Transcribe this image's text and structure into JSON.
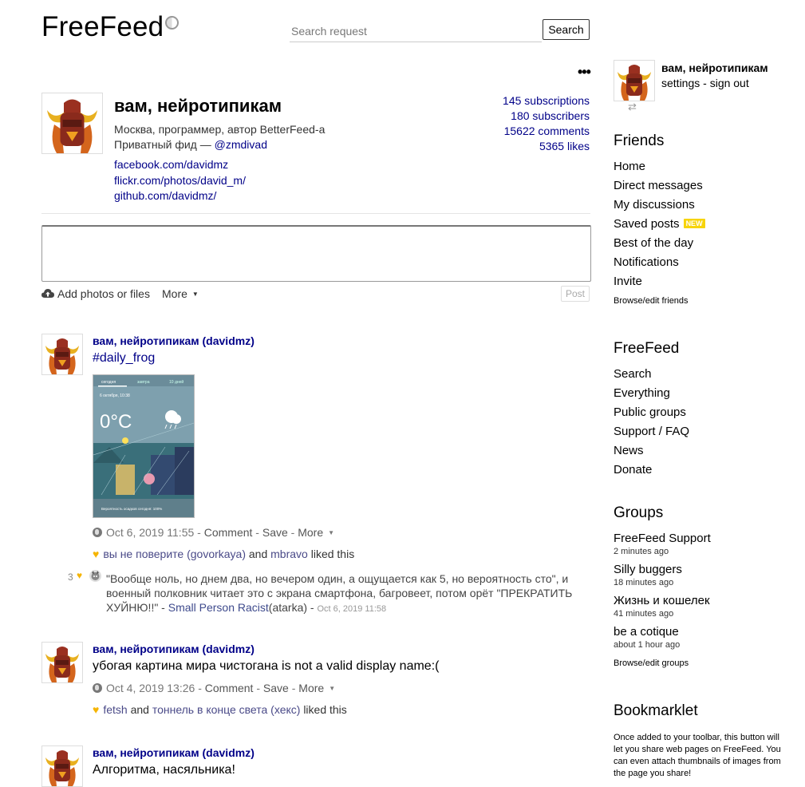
{
  "header": {
    "logo": "FreeFeed",
    "search_placeholder": "Search request",
    "search_button": "Search"
  },
  "profile": {
    "menu_dots": "•••",
    "name": "вам, нейротипикам",
    "description": "Москва, программер, автор BetterFeed-а",
    "private_prefix": "Приватный фид — ",
    "private_handle": "@zmdivad",
    "links": [
      "facebook.com/davidmz",
      "flickr.com/photos/david_m/",
      "github.com/davidmz/"
    ],
    "stats": {
      "subscriptions": "145 subscriptions",
      "subscribers": "180 subscribers",
      "comments": "15622 comments",
      "likes": "5365 likes"
    }
  },
  "composer": {
    "attach_label": "Add photos or files",
    "more_label": "More",
    "post_button": "Post"
  },
  "posts": [
    {
      "author": "вам, нейротипикам (davidmz)",
      "body": "#daily_frog",
      "date": "Oct 6, 2019 11:55",
      "actions": {
        "comment": "Comment",
        "save": "Save",
        "more": "More"
      },
      "likes": {
        "user1": "вы не поверите (govorkaya)",
        "and": "and",
        "user2": "mbravo",
        "suffix": "liked this"
      },
      "comment": {
        "likes_count": "3",
        "text": "\"Вообще ноль, но днем два, но вечером один, а ощущается как 5, но вероятность сто\", и военный полковник читает это с экрана смартфона, багровеет, потом орёт \"ПРЕКРАТИТЬ ХУЙНЮ!!\" - ",
        "author": "Small Person Racist",
        "author_handle": "(atarka)",
        "date": "Oct 6, 2019 11:58"
      },
      "image": {
        "tabs": [
          "сегодня",
          "завтра",
          "10 дней"
        ],
        "date": "6 октября, 10:38",
        "temp": "0°C",
        "footer": "Вероятность осадков сегодня: 100%"
      }
    },
    {
      "author": "вам, нейротипикам (davidmz)",
      "body": "убогая картина мира чистогана is not a valid display name:(",
      "date": "Oct 4, 2019 13:26",
      "actions": {
        "comment": "Comment",
        "save": "Save",
        "more": "More"
      },
      "likes": {
        "user1": "fetsh",
        "and": "and",
        "user2": "тоннель в конце света (хекс)",
        "suffix": "liked this"
      }
    },
    {
      "author": "вам, нейротипикам (davidmz)",
      "body": "Алгоритма, насяльника!"
    }
  ],
  "sidebar": {
    "user_name": "вам, нейротипикам",
    "settings": "settings",
    "separator": " - ",
    "sign_out": "sign out",
    "friends": {
      "heading": "Friends",
      "items": [
        "Home",
        "Direct messages",
        "My discussions",
        "Saved posts",
        "Best of the day",
        "Notifications",
        "Invite"
      ],
      "new_badge": "NEW",
      "browse": "Browse/edit friends"
    },
    "freefeed": {
      "heading": "FreeFeed",
      "items": [
        "Search",
        "Everything",
        "Public groups",
        "Support / FAQ",
        "News",
        "Donate"
      ]
    },
    "groups": {
      "heading": "Groups",
      "items": [
        {
          "name": "FreeFeed Support",
          "time": "2 minutes ago"
        },
        {
          "name": "Silly buggers",
          "time": "18 minutes ago"
        },
        {
          "name": "Жизнь и кошелек",
          "time": "41 minutes ago"
        },
        {
          "name": "be a cotique",
          "time": "about 1 hour ago"
        }
      ],
      "browse": "Browse/edit groups"
    },
    "bookmarklet": {
      "heading": "Bookmarklet",
      "text": "Once added to your toolbar, this button will let you share web pages on FreeFeed. You can even attach thumbnails of images from the page you share!"
    }
  },
  "colors": {
    "link": "#000088",
    "heart": "#f5b400",
    "new_badge": "#f7d40b"
  }
}
